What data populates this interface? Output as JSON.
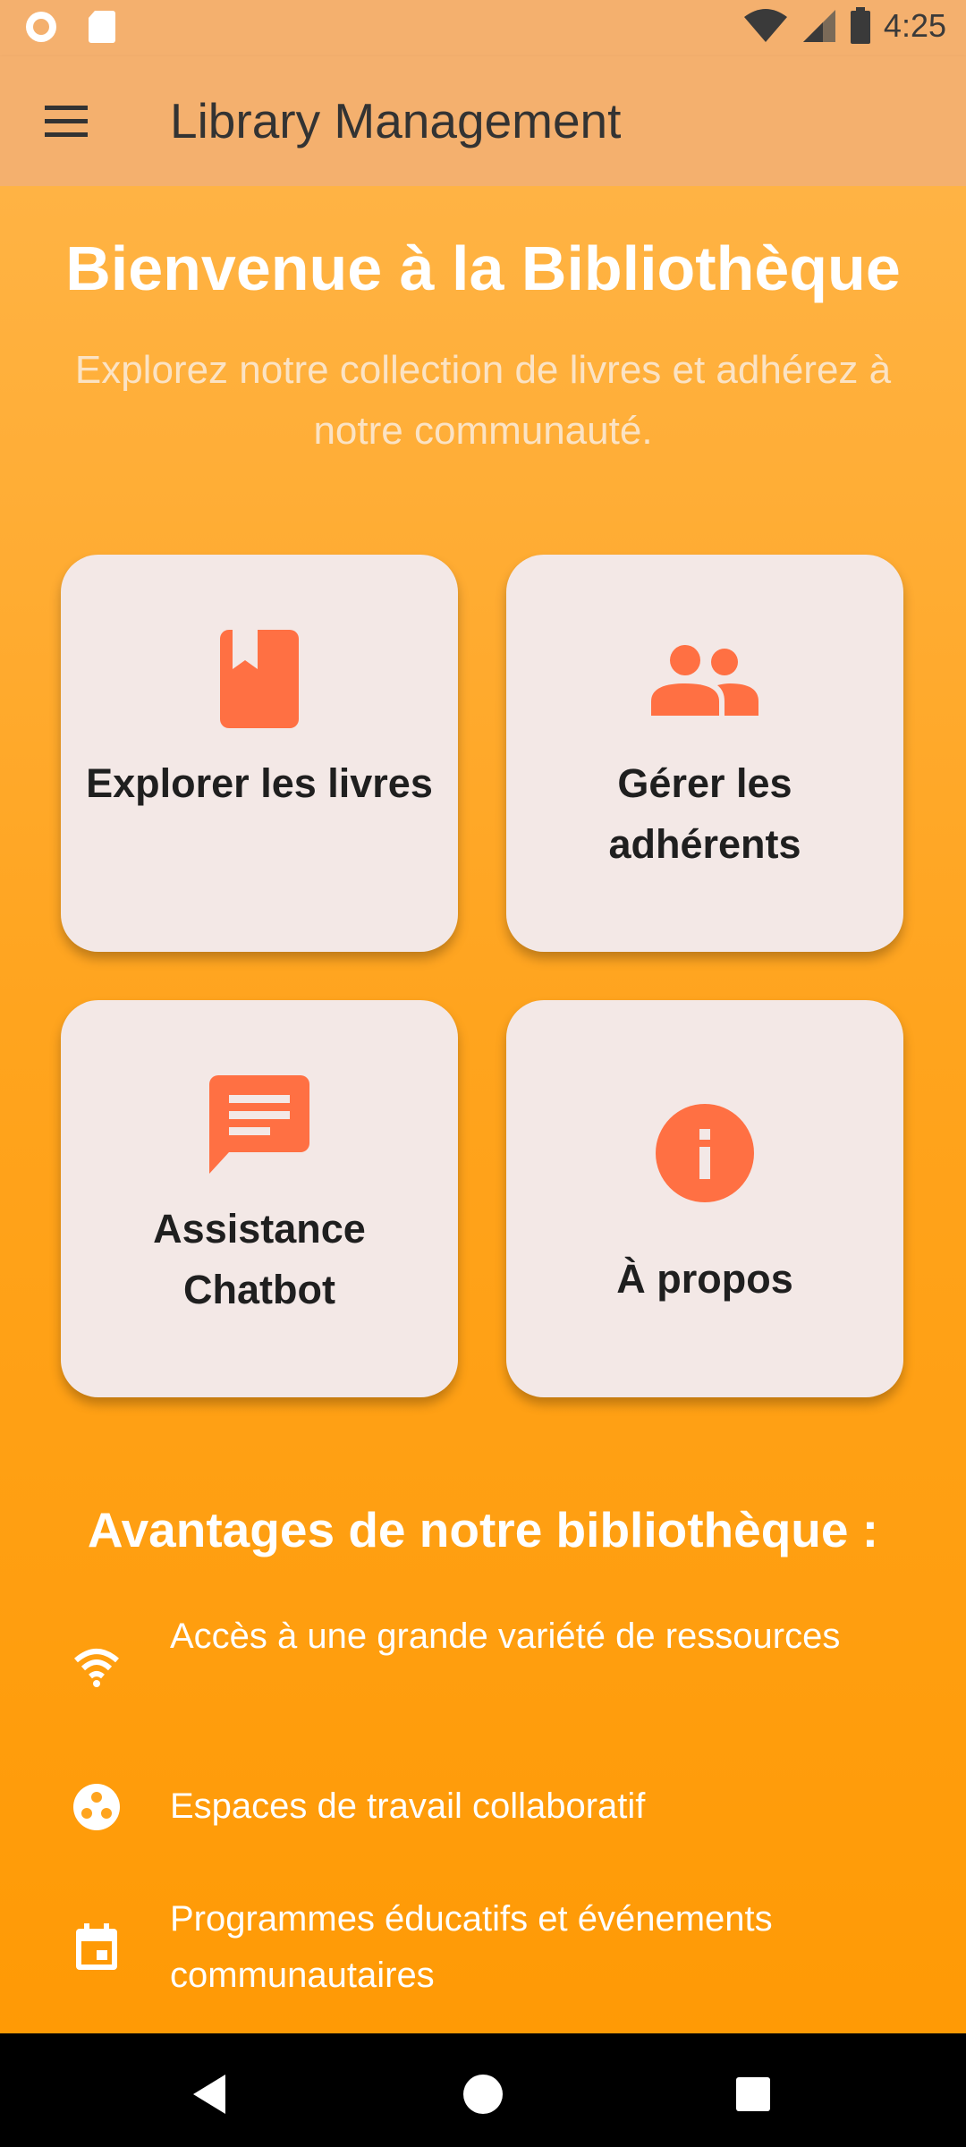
{
  "status": {
    "time": "4:25",
    "icons": [
      "record-icon",
      "sd-card-icon",
      "wifi-icon",
      "signal-icon",
      "battery-icon"
    ]
  },
  "app_bar": {
    "title": "Library Management",
    "menu_icon": "menu-icon"
  },
  "welcome": {
    "title": "Bienvenue à la Bibliothèque",
    "subtitle": "Explorez notre collection de livres et adhérez à notre communauté."
  },
  "cards": [
    {
      "label": "Explorer les livres",
      "icon": "book-icon"
    },
    {
      "label": "Gérer les adhérents",
      "icon": "people-icon"
    },
    {
      "label": "Assistance Chatbot",
      "icon": "chat-icon"
    },
    {
      "label": "À propos",
      "icon": "info-icon"
    }
  ],
  "benefits": {
    "title": "Avantages de notre bibliothèque :",
    "items": [
      {
        "text": "Accès à une grande variété de ressources",
        "icon": "wifi-icon"
      },
      {
        "text": "Espaces de travail collaboratif",
        "icon": "workspaces-icon"
      },
      {
        "text": "Programmes éducatifs et événements communautaires",
        "icon": "calendar-icon"
      }
    ]
  },
  "nav_bar": {
    "icons": [
      "back-icon",
      "home-icon",
      "recents-icon"
    ]
  },
  "colors": {
    "accent": "#FF7043",
    "app_bar": "#F4B06E",
    "background_top": "#FFB344",
    "background_bottom": "#FF9A05",
    "card": "#F3E8E6"
  }
}
